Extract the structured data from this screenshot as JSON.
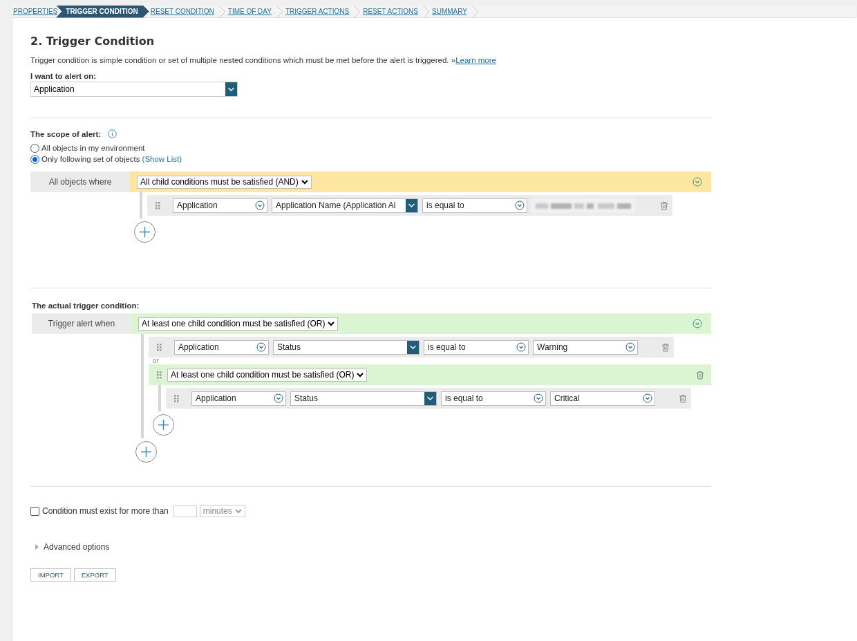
{
  "breadcrumb": [
    {
      "label": "PROPERTIES",
      "selected": false
    },
    {
      "label": "TRIGGER CONDITION",
      "selected": true
    },
    {
      "label": "RESET CONDITION",
      "selected": false
    },
    {
      "label": "TIME OF DAY",
      "selected": false
    },
    {
      "label": "TRIGGER ACTIONS",
      "selected": false
    },
    {
      "label": "RESET ACTIONS",
      "selected": false
    },
    {
      "label": "SUMMARY",
      "selected": false
    }
  ],
  "heading": "2. Trigger Condition",
  "description": "Trigger condition is simple condition or set of multiple nested conditions which must be met before the alert is triggered. »",
  "learn_more": "Learn more",
  "alert_on": {
    "label": "I want to alert on:",
    "value": "Application"
  },
  "scope": {
    "label": "The scope of alert:",
    "options": [
      {
        "label": "All objects in my environment",
        "selected": false
      },
      {
        "label": "Only following set of objects",
        "link": "(Show List)",
        "selected": true
      }
    ],
    "group": {
      "label": "All objects where",
      "kind": "and",
      "operator": "All child conditions must be satisfied (AND)",
      "children": [
        {
          "kind": "condition",
          "object": "Application",
          "field": "Application Name (Application Al",
          "operator": "is equal to",
          "redacted": true
        }
      ]
    }
  },
  "trigger": {
    "label": "The actual trigger condition:",
    "group": {
      "label": "Trigger alert when",
      "kind": "or",
      "operator": "At least one child condition must be satisfied (OR)",
      "joiner": "or",
      "children": [
        {
          "kind": "condition",
          "object": "Application",
          "field": "Status",
          "operator": "is equal to",
          "value": "Warning",
          "redacted": false
        },
        {
          "kind": "group",
          "operator": "At least one child condition must be satisfied (OR)",
          "children": [
            {
              "kind": "condition",
              "object": "Application",
              "field": "Status",
              "operator": "is equal to",
              "value": "Critical",
              "redacted": false
            }
          ]
        }
      ]
    }
  },
  "duration": {
    "checked": false,
    "label": "Condition must exist for more than",
    "unit": "minutes"
  },
  "advanced": {
    "label": "Advanced options",
    "expanded": false
  },
  "buttons": [
    "IMPORT",
    "EXPORT"
  ]
}
